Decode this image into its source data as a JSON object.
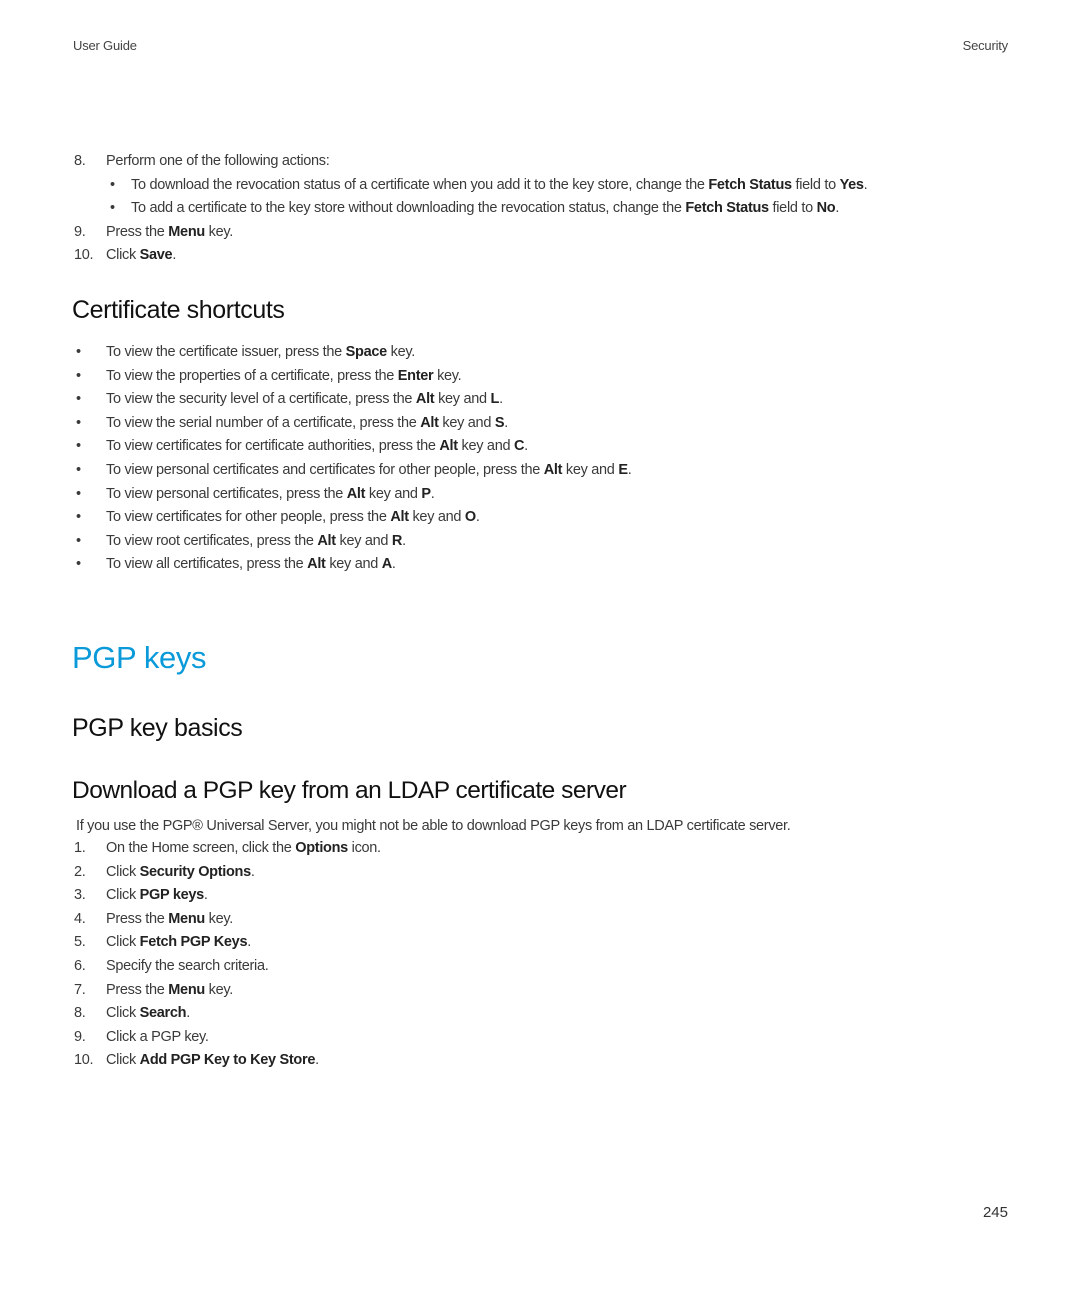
{
  "header": {
    "left": "User Guide",
    "right": "Security"
  },
  "continued_steps": [
    {
      "num": "8.",
      "segments": [
        {
          "t": "Perform one of the following actions:",
          "b": false
        }
      ],
      "sub": [
        {
          "segments": [
            {
              "t": "To download the revocation status of a certificate when you add it to the key store, change the ",
              "b": false
            },
            {
              "t": "Fetch Status",
              "b": true
            },
            {
              "t": " field to ",
              "b": false
            },
            {
              "t": "Yes",
              "b": true
            },
            {
              "t": ".",
              "b": false
            }
          ]
        },
        {
          "segments": [
            {
              "t": "To add a certificate to the key store without downloading the revocation status, change the ",
              "b": false
            },
            {
              "t": "Fetch Status",
              "b": true
            },
            {
              "t": " field to ",
              "b": false
            },
            {
              "t": "No",
              "b": true
            },
            {
              "t": ".",
              "b": false
            }
          ]
        }
      ]
    },
    {
      "num": "9.",
      "segments": [
        {
          "t": "Press the ",
          "b": false
        },
        {
          "t": "Menu",
          "b": true
        },
        {
          "t": " key.",
          "b": false
        }
      ]
    },
    {
      "num": "10.",
      "segments": [
        {
          "t": "Click ",
          "b": false
        },
        {
          "t": "Save",
          "b": true
        },
        {
          "t": ".",
          "b": false
        }
      ]
    }
  ],
  "certificate_shortcuts": {
    "title": "Certificate shortcuts",
    "items": [
      [
        {
          "t": "To view the certificate issuer, press the ",
          "b": false
        },
        {
          "t": "Space",
          "b": true
        },
        {
          "t": " key.",
          "b": false
        }
      ],
      [
        {
          "t": "To view the properties of a certificate, press the ",
          "b": false
        },
        {
          "t": "Enter",
          "b": true
        },
        {
          "t": " key.",
          "b": false
        }
      ],
      [
        {
          "t": "To view the security level of a certificate, press the ",
          "b": false
        },
        {
          "t": "Alt",
          "b": true
        },
        {
          "t": " key and ",
          "b": false
        },
        {
          "t": "L",
          "b": true
        },
        {
          "t": ".",
          "b": false
        }
      ],
      [
        {
          "t": "To view the serial number of a certificate, press the ",
          "b": false
        },
        {
          "t": "Alt",
          "b": true
        },
        {
          "t": " key and ",
          "b": false
        },
        {
          "t": "S",
          "b": true
        },
        {
          "t": ".",
          "b": false
        }
      ],
      [
        {
          "t": "To view certificates for certificate authorities, press the ",
          "b": false
        },
        {
          "t": "Alt",
          "b": true
        },
        {
          "t": " key and ",
          "b": false
        },
        {
          "t": "C",
          "b": true
        },
        {
          "t": ".",
          "b": false
        }
      ],
      [
        {
          "t": "To view personal certificates and certificates for other people, press the ",
          "b": false
        },
        {
          "t": "Alt",
          "b": true
        },
        {
          "t": " key and ",
          "b": false
        },
        {
          "t": "E",
          "b": true
        },
        {
          "t": ".",
          "b": false
        }
      ],
      [
        {
          "t": "To view personal certificates, press the ",
          "b": false
        },
        {
          "t": "Alt",
          "b": true
        },
        {
          "t": " key and ",
          "b": false
        },
        {
          "t": "P",
          "b": true
        },
        {
          "t": ".",
          "b": false
        }
      ],
      [
        {
          "t": "To view certificates for other people, press the ",
          "b": false
        },
        {
          "t": "Alt",
          "b": true
        },
        {
          "t": " key and ",
          "b": false
        },
        {
          "t": "O",
          "b": true
        },
        {
          "t": ".",
          "b": false
        }
      ],
      [
        {
          "t": "To view root certificates, press the ",
          "b": false
        },
        {
          "t": "Alt",
          "b": true
        },
        {
          "t": " key and ",
          "b": false
        },
        {
          "t": "R",
          "b": true
        },
        {
          "t": ".",
          "b": false
        }
      ],
      [
        {
          "t": "To view all certificates, press the ",
          "b": false
        },
        {
          "t": "Alt",
          "b": true
        },
        {
          "t": " key and ",
          "b": false
        },
        {
          "t": "A",
          "b": true
        },
        {
          "t": ".",
          "b": false
        }
      ]
    ]
  },
  "pgp_section": {
    "title": "PGP keys",
    "title_color": "#0a9ad9",
    "subsection_title": "PGP key basics",
    "task_title": "Download a PGP key from an LDAP certificate server",
    "intro": "If you use the PGP® Universal Server, you might not be able to download PGP keys from an LDAP certificate server.",
    "steps": [
      {
        "num": "1.",
        "segments": [
          {
            "t": "On the Home screen, click the ",
            "b": false
          },
          {
            "t": "Options",
            "b": true
          },
          {
            "t": " icon.",
            "b": false
          }
        ]
      },
      {
        "num": "2.",
        "segments": [
          {
            "t": "Click ",
            "b": false
          },
          {
            "t": "Security Options",
            "b": true
          },
          {
            "t": ".",
            "b": false
          }
        ]
      },
      {
        "num": "3.",
        "segments": [
          {
            "t": "Click ",
            "b": false
          },
          {
            "t": "PGP keys",
            "b": true
          },
          {
            "t": ".",
            "b": false
          }
        ]
      },
      {
        "num": "4.",
        "segments": [
          {
            "t": "Press the ",
            "b": false
          },
          {
            "t": "Menu",
            "b": true
          },
          {
            "t": " key.",
            "b": false
          }
        ]
      },
      {
        "num": "5.",
        "segments": [
          {
            "t": "Click ",
            "b": false
          },
          {
            "t": "Fetch PGP Keys",
            "b": true
          },
          {
            "t": ".",
            "b": false
          }
        ]
      },
      {
        "num": "6.",
        "segments": [
          {
            "t": "Specify the search criteria.",
            "b": false
          }
        ]
      },
      {
        "num": "7.",
        "segments": [
          {
            "t": "Press the ",
            "b": false
          },
          {
            "t": "Menu",
            "b": true
          },
          {
            "t": " key.",
            "b": false
          }
        ]
      },
      {
        "num": "8.",
        "segments": [
          {
            "t": "Click ",
            "b": false
          },
          {
            "t": "Search",
            "b": true
          },
          {
            "t": ".",
            "b": false
          }
        ]
      },
      {
        "num": "9.",
        "segments": [
          {
            "t": "Click a PGP key.",
            "b": false
          }
        ]
      },
      {
        "num": "10.",
        "segments": [
          {
            "t": "Click ",
            "b": false
          },
          {
            "t": "Add PGP Key to Key Store",
            "b": true
          },
          {
            "t": ".",
            "b": false
          }
        ]
      }
    ]
  },
  "footer": {
    "page_number": "245"
  },
  "bullet_glyph": "•"
}
